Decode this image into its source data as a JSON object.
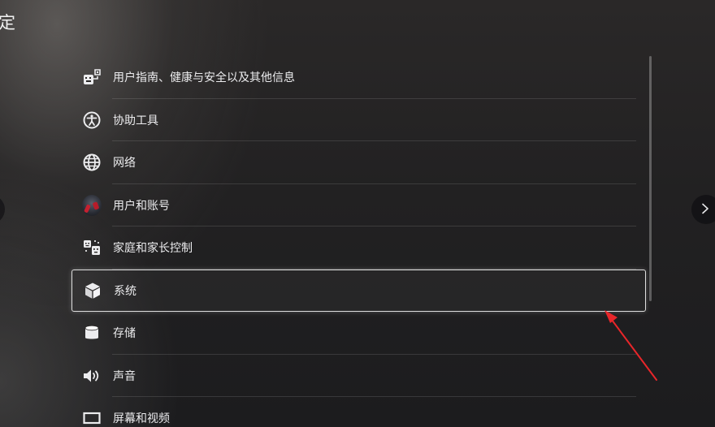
{
  "header": {
    "title_fragment": "定"
  },
  "settings_list": {
    "items": [
      {
        "label": "用户指南、健康与安全以及其他信息",
        "icon": "user-guide-icon"
      },
      {
        "label": "协助工具",
        "icon": "accessibility-icon"
      },
      {
        "label": "网络",
        "icon": "globe-icon"
      },
      {
        "label": "用户和账号",
        "icon": "avatar"
      },
      {
        "label": "家庭和家长控制",
        "icon": "family-icon"
      },
      {
        "label": "系统",
        "icon": "cube-icon",
        "selected": true
      },
      {
        "label": "存储",
        "icon": "storage-icon"
      },
      {
        "label": "声音",
        "icon": "speaker-icon"
      },
      {
        "label": "屏幕和视频",
        "icon": "screen-icon"
      }
    ]
  },
  "colors": {
    "annotation_arrow": "#e8262a",
    "selection_border": "#dedede"
  }
}
